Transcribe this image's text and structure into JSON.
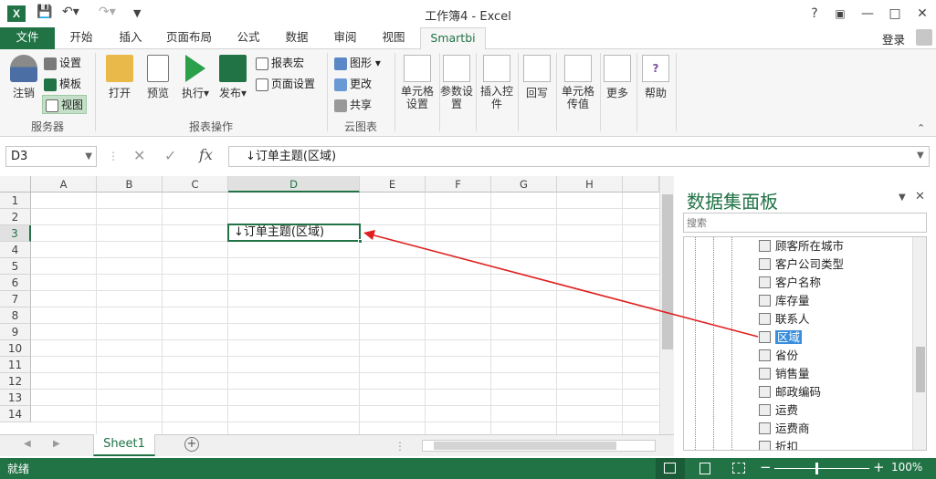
{
  "titlebar": {
    "title": "工作簿4 - Excel",
    "help": "?",
    "login": "登录"
  },
  "tabs": [
    "文件",
    "开始",
    "插入",
    "页面布局",
    "公式",
    "数据",
    "审阅",
    "视图",
    "Smartbi"
  ],
  "ribbon": {
    "server": {
      "logout": "注销",
      "settings": "设置",
      "template": "模板",
      "view": "视图",
      "group": "服务器"
    },
    "report": {
      "open": "打开",
      "preview": "预览",
      "execute": "执行",
      "publish": "发布",
      "macro": "报表宏",
      "page_setup": "页面设置",
      "group": "报表操作"
    },
    "cloud": {
      "graph": "图形",
      "update": "更改",
      "share": "共享",
      "group": "云图表"
    },
    "cell_settings": "单元格设置",
    "param_settings": "参数设置",
    "insert_control": "插入控件",
    "writeback": "回写",
    "cell_pass": "单元格传值",
    "more": "更多",
    "help": "帮助"
  },
  "formula_bar": {
    "namebox": "D3",
    "formula": "↓订单主题(区域)",
    "fx": "fx"
  },
  "grid": {
    "columns": [
      "A",
      "B",
      "C",
      "D",
      "E",
      "F",
      "G",
      "H"
    ],
    "rows": [
      "1",
      "2",
      "3",
      "4",
      "5",
      "6",
      "7",
      "8",
      "9",
      "10",
      "11",
      "12",
      "13",
      "14"
    ],
    "d3_value": "↓订单主题(区域)"
  },
  "sheets": {
    "active": "Sheet1",
    "add": "+"
  },
  "status": {
    "text": "就绪",
    "zoom": "100%"
  },
  "panel": {
    "title": "数据集面板",
    "search_placeholder": "搜索",
    "items": [
      "顾客所在城市",
      "客户公司类型",
      "客户名称",
      "库存量",
      "联系人",
      "区域",
      "省份",
      "销售量",
      "邮政编码",
      "运费",
      "运费商",
      "折扣"
    ],
    "selected": "区域"
  },
  "colors": {
    "accent": "#217346",
    "arrow": "#e02020",
    "selected": "#3b8edb"
  }
}
